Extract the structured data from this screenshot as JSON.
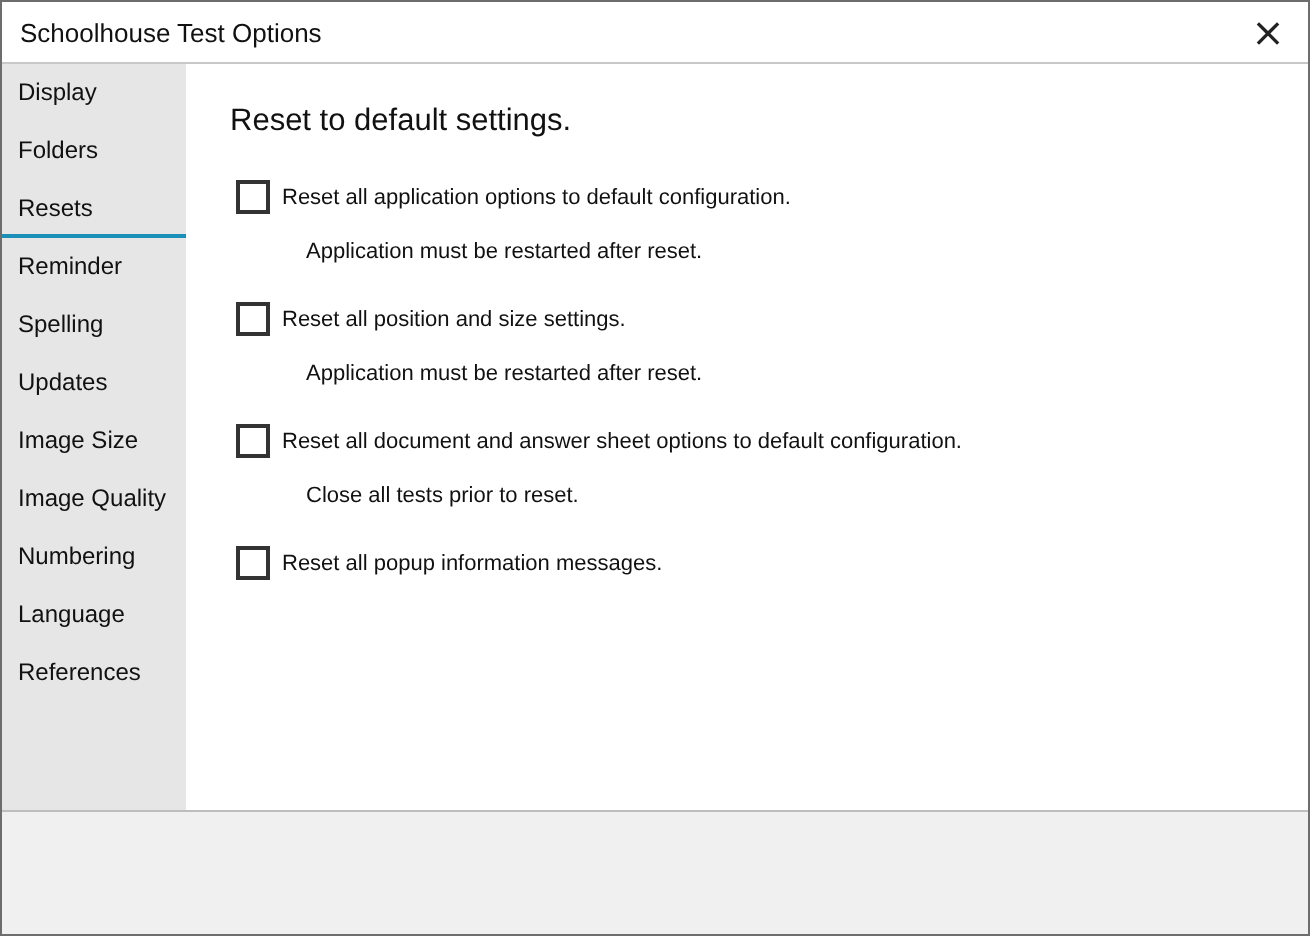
{
  "window": {
    "title": "Schoolhouse Test Options",
    "close": "×"
  },
  "sidebar": {
    "items": [
      {
        "label": "Display",
        "selected": false
      },
      {
        "label": "Folders",
        "selected": false
      },
      {
        "label": "Resets",
        "selected": true
      },
      {
        "label": "Reminder",
        "selected": false
      },
      {
        "label": "Spelling",
        "selected": false
      },
      {
        "label": "Updates",
        "selected": false
      },
      {
        "label": "Image Size",
        "selected": false
      },
      {
        "label": "Image Quality",
        "selected": false
      },
      {
        "label": "Numbering",
        "selected": false
      },
      {
        "label": "Language",
        "selected": false
      },
      {
        "label": "References",
        "selected": false
      }
    ]
  },
  "heading": "Reset to default settings.",
  "options": [
    {
      "label": "Reset all application options to default configuration.",
      "checked": false,
      "note": "Application must be restarted after reset."
    },
    {
      "label": "Reset all position and size settings.",
      "checked": false,
      "note": "Application must be restarted after reset."
    },
    {
      "label": "Reset all document and answer sheet options to default configuration.",
      "checked": false,
      "note": "Close all tests prior to reset."
    },
    {
      "label": "Reset all popup information messages.",
      "checked": false
    }
  ]
}
